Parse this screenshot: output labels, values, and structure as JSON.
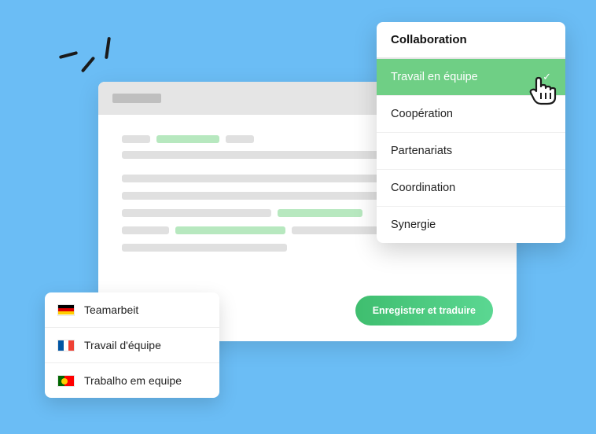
{
  "editor": {
    "save_button": "Enregistrer et traduire"
  },
  "dropdown": {
    "header": "Collaboration",
    "selected_index": 0,
    "items": [
      "Travail en équipe",
      "Coopération",
      "Partenariats",
      "Coordination",
      "Synergie"
    ]
  },
  "translations": [
    {
      "flag": "de",
      "text": "Teamarbeit"
    },
    {
      "flag": "fr",
      "text": "Travail d'équipe"
    },
    {
      "flag": "pt",
      "text": "Trabalho em equipe"
    }
  ]
}
